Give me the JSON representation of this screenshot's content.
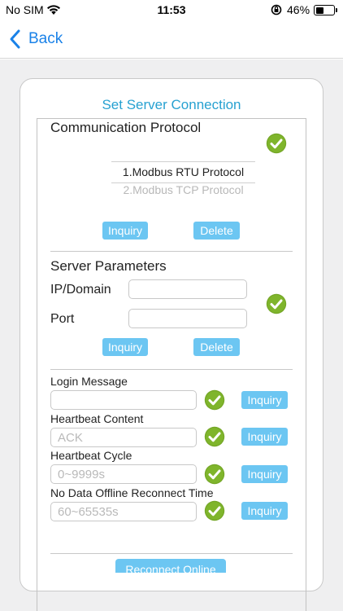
{
  "status_bar": {
    "carrier": "No SIM",
    "time": "11:53",
    "battery": "46%",
    "battery_level": 0.46
  },
  "nav": {
    "back_label": "Back"
  },
  "page": {
    "title": "Set Server Connection"
  },
  "protocol": {
    "title": "Communication Protocol",
    "options": [
      "1.Modbus RTU Protocol",
      "2.Modbus TCP Protocol"
    ],
    "selected_index": 0,
    "inquiry_label": "Inquiry",
    "delete_label": "Delete"
  },
  "server": {
    "title": "Server Parameters",
    "ip_label": "IP/Domain",
    "ip_value": "",
    "port_label": "Port",
    "port_value": "",
    "inquiry_label": "Inquiry",
    "delete_label": "Delete"
  },
  "params": [
    {
      "label": "Login Message",
      "placeholder": "",
      "button": "Inquiry"
    },
    {
      "label": "Heartbeat Content",
      "placeholder": "ACK",
      "button": "Inquiry"
    },
    {
      "label": "Heartbeat Cycle",
      "placeholder": "0~9999s",
      "button": "Inquiry"
    },
    {
      "label": "No Data Offline Reconnect Time",
      "placeholder": "60~65535s",
      "button": "Inquiry"
    }
  ],
  "reconnect_label": "Reconnect Online",
  "colors": {
    "accent": "#1a82e8",
    "title": "#27a1d1",
    "button": "#6cc6f2",
    "check": "#74a626"
  }
}
